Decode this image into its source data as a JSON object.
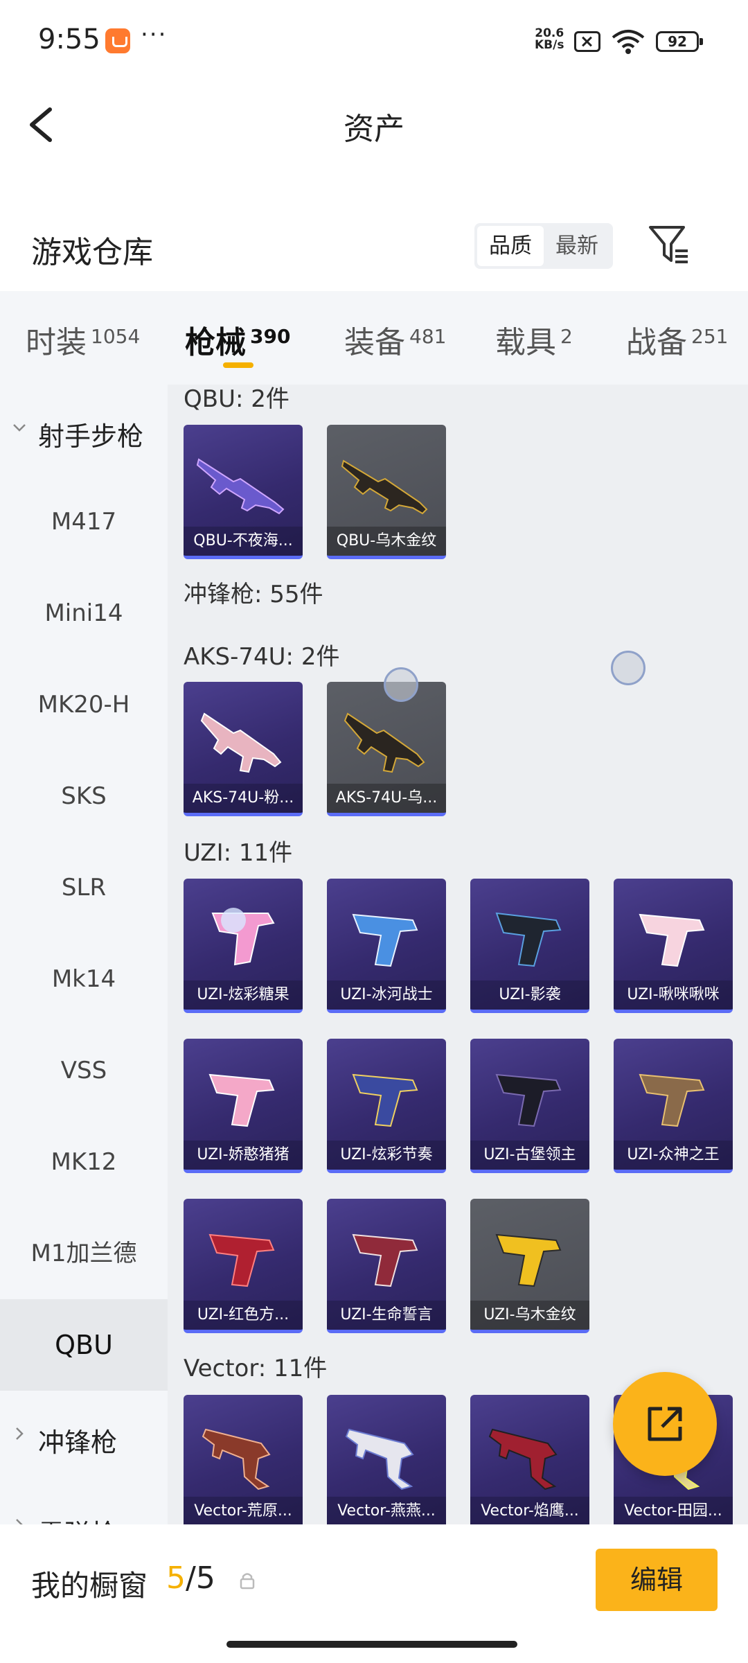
{
  "status_bar": {
    "time": "9:55",
    "more": "···",
    "speed_value": "20.6",
    "speed_unit": "KB/s",
    "battery": "92"
  },
  "header": {
    "title": "资产"
  },
  "section": {
    "title": "游戏仓库",
    "sort_options": [
      "品质",
      "最新"
    ],
    "active_sort": "品质"
  },
  "tabs": [
    {
      "label": "时装",
      "count": "1054"
    },
    {
      "label": "枪械",
      "count": "390"
    },
    {
      "label": "装备",
      "count": "481"
    },
    {
      "label": "载具",
      "count": "2"
    },
    {
      "label": "战备",
      "count": "251"
    }
  ],
  "active_tab": "枪械",
  "sidebar": {
    "group_open": "射手步枪",
    "items": [
      "M417",
      "Mini14",
      "MK20-H",
      "SKS",
      "SLR",
      "Mk14",
      "VSS",
      "MK12",
      "M1加兰德",
      "QBU"
    ],
    "active_item": "QBU",
    "group_closed_1": "冲锋枪",
    "group_closed_2": "霰弹枪"
  },
  "content": {
    "qbu": {
      "label": "QBU: 2件",
      "cards": [
        "QBU-不夜海...",
        "QBU-乌木金纹"
      ]
    },
    "smg_category": "冲锋枪: 55件",
    "aks": {
      "label": "AKS-74U: 2件",
      "cards": [
        "AKS-74U-粉...",
        "AKS-74U-乌..."
      ]
    },
    "uzi": {
      "label": "UZI: 11件",
      "cards": [
        "UZI-炫彩糖果",
        "UZI-冰河战士",
        "UZI-影袭",
        "UZI-啾咪啾咪",
        "UZI-娇憨猪猪",
        "UZI-炫彩节奏",
        "UZI-古堡领主",
        "UZI-众神之王",
        "UZI-红色方...",
        "UZI-生命誓言",
        "UZI-乌木金纹"
      ]
    },
    "vector": {
      "label": "Vector: 11件",
      "cards": [
        "Vector-荒原...",
        "Vector-燕燕...",
        "Vector-焰鹰...",
        "Vector-田园..."
      ]
    }
  },
  "bottom": {
    "showcase_label": "我的橱窗",
    "current": "5",
    "separator": "/",
    "total": "5",
    "edit_label": "编辑"
  },
  "colors": {
    "accent": "#fbb31a",
    "card_purple": "#3a2f78",
    "card_gray": "#55575e",
    "card_border": "#5b6cf6"
  }
}
